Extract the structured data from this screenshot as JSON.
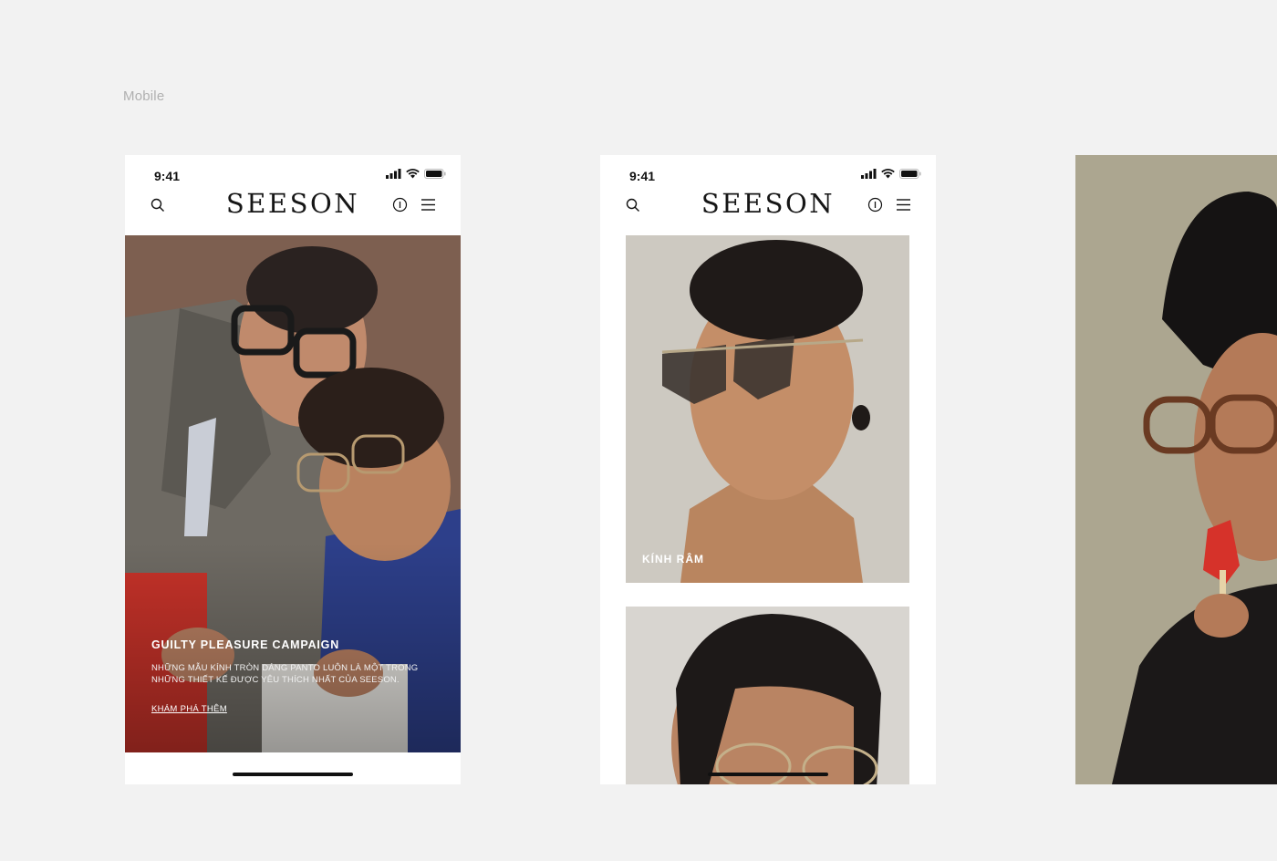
{
  "section_label": "Mobile",
  "phone_home": {
    "status": {
      "time": "9:41"
    },
    "brand": "SEESON",
    "hero": {
      "title": "GUILTY PLEASURE CAMPAIGN",
      "description": "NHỮNG MẪU KÍNH TRÒN DÁNG PANTO LUÔN LÀ MỘT TRONG NHỮNG THIẾT KẾ ĐƯỢC YÊU THÍCH NHẤT CỦA SEESON.",
      "cta": "KHÁM PHÁ THÊM"
    }
  },
  "phone_category": {
    "status": {
      "time": "9:41"
    },
    "brand": "SEESON",
    "cards": [
      {
        "label": "KÍNH RÂM"
      }
    ]
  },
  "colors": {
    "page_bg": "#f2f2f2",
    "text_dark": "#161616",
    "label_gray": "#b0b0b0"
  },
  "icons": [
    "search-icon",
    "info-icon",
    "menu-icon",
    "signal-icon",
    "wifi-icon",
    "battery-icon"
  ]
}
